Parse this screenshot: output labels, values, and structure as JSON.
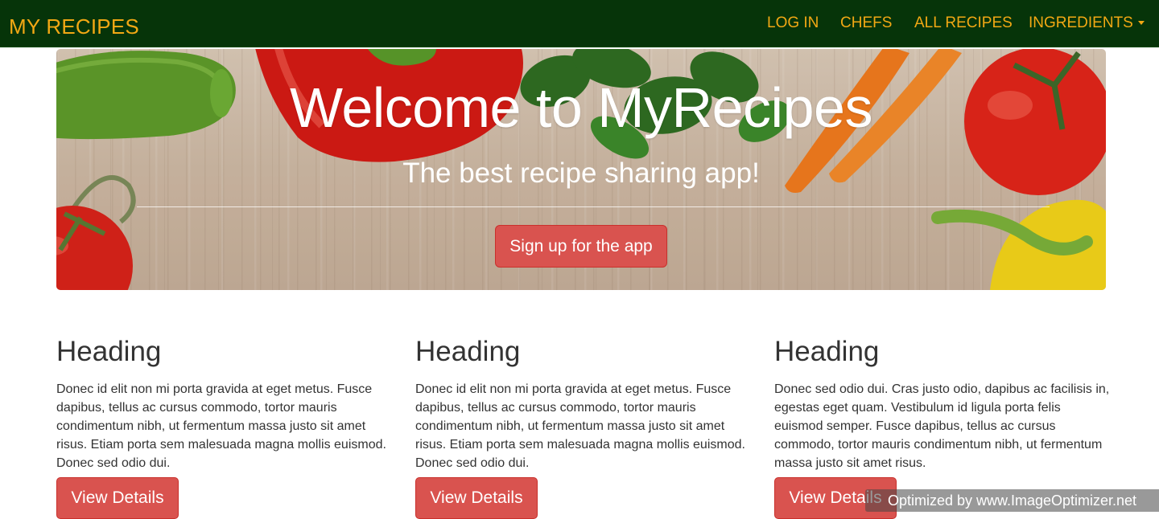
{
  "navbar": {
    "brand": "MY RECIPES",
    "items": [
      {
        "label": "LOG IN"
      },
      {
        "label": "CHEFS"
      },
      {
        "label": "ALL RECIPES"
      },
      {
        "label": "INGREDIENTS"
      }
    ]
  },
  "hero": {
    "title": "Welcome to MyRecipes",
    "subtitle": "The best recipe sharing app!",
    "button_label": "Sign up for the app"
  },
  "columns": [
    {
      "heading": "Heading",
      "text": "Donec id elit non mi porta gravida at eget metus. Fusce dapibus, tellus ac cursus commodo, tortor mauris condimentum nibh, ut fermentum massa justo sit amet risus. Etiam porta sem malesuada magna mollis euismod. Donec sed odio dui.",
      "button_label": "View Details"
    },
    {
      "heading": "Heading",
      "text": "Donec id elit non mi porta gravida at eget metus. Fusce dapibus, tellus ac cursus commodo, tortor mauris condimentum nibh, ut fermentum massa justo sit amet risus. Etiam porta sem malesuada magna mollis euismod. Donec sed odio dui.",
      "button_label": "View Details"
    },
    {
      "heading": "Heading",
      "text": "Donec sed odio dui. Cras justo odio, dapibus ac facilisis in, egestas eget quam. Vestibulum id ligula porta felis euismod semper. Fusce dapibus, tellus ac cursus commodo, tortor mauris condimentum nibh, ut fermentum massa justo sit amet risus.",
      "button_label": "View Details"
    }
  ],
  "watermark": "Optimized by www.ImageOptimizer.net",
  "colors": {
    "navbar_bg": "#063409",
    "nav_text": "#f2a814",
    "button": "#d9534f"
  }
}
